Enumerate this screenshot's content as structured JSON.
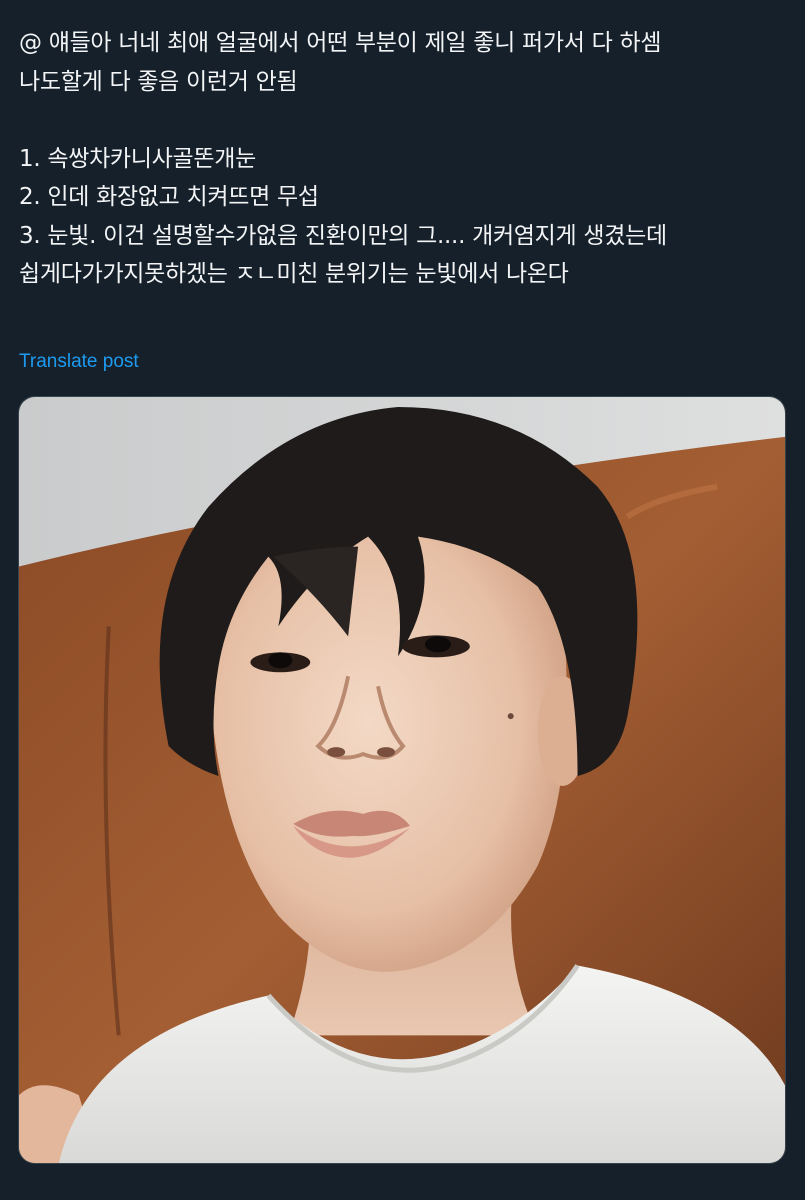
{
  "post": {
    "text_lines": [
      "@ 얘들아 너네 최애 얼굴에서 어떤 부분이 제일 좋니 퍼가서 다 하셈",
      "나도할게 다 좋음 이런거 안됨",
      "",
      "1. 속쌍차카니사골똔개눈",
      "2. 인데 화장없고 치켜뜨면 무섭",
      "3. 눈빛. 이건 설명할수가없음 진환이만의 그.... 개커염지게 생겼는데",
      "쉽게다가가지못하겠는 ㅈㄴ미친 분위기는 눈빛에서 나온다"
    ],
    "translate_label": "Translate post",
    "media": {
      "alt": "selfie photo"
    }
  },
  "colors": {
    "background": "#15202b",
    "text": "#f2f4f5",
    "link": "#1d9bf0",
    "border": "#38444d"
  }
}
